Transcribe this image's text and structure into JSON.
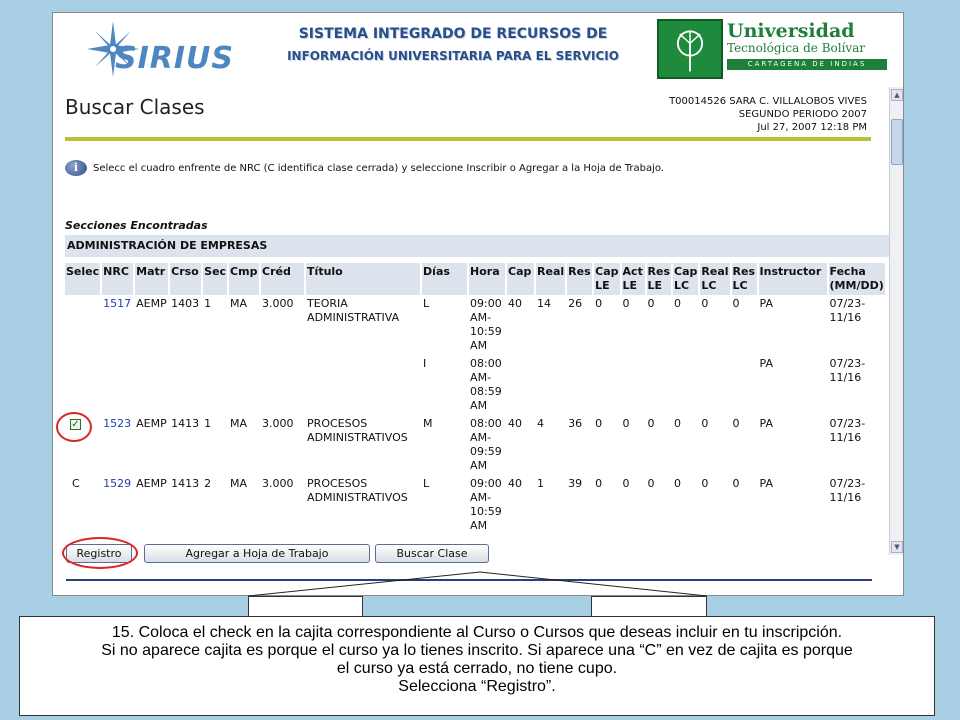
{
  "banner": {
    "sirius_logo_text": "SIRIUS",
    "system_title_line1": "SISTEMA INTEGRADO DE RECURSOS DE",
    "system_title_line2": "INFORMACIÓN UNIVERSITARIA PARA EL SERVICIO",
    "university_line1": "Universidad",
    "university_line2": "Tecnológica de Bolívar",
    "university_line3": "CARTAGENA DE INDIAS"
  },
  "page": {
    "title": "Buscar Clases",
    "user_line": "T00014526 SARA C. VILLALOBOS VIVES",
    "period_line": "SEGUNDO PERIODO 2007",
    "datetime_line": "Jul 27, 2007 12:18 PM",
    "info_message": "Selecc el cuadro enfrente de NRC (C identifica clase cerrada) y seleccione Inscribir o Agregar a la Hoja de Trabajo.",
    "sections_label": "Secciones Encontradas",
    "department": "ADMINISTRACIÓN DE EMPRESAS"
  },
  "table": {
    "headers": [
      "Selec",
      "NRC",
      "Matr",
      "Crso",
      "Sec",
      "Cmp",
      "Créd",
      "Título",
      "Días",
      "Hora",
      "Cap",
      "Real",
      "Res",
      "Cap LE",
      "Act LE",
      "Res LE",
      "Cap LC",
      "Real LC",
      "Res LC",
      "Instructor",
      "Fecha (MM/DD)"
    ],
    "rows": [
      {
        "select": "",
        "nrc": "1517",
        "matr": "AEMP",
        "crso": "1403",
        "sec": "1",
        "cmp": "MA",
        "cred": "3.000",
        "titulo": "TEORIA ADMINISTRATIVA",
        "dias": "L",
        "hora": "09:00 AM-10:59 AM",
        "cap": "40",
        "real": "14",
        "res": "26",
        "caple": "0",
        "actle": "0",
        "resle": "0",
        "caplc": "0",
        "reallc": "0",
        "reslc": "0",
        "instructor": "PA",
        "fecha": "07/23-11/16"
      },
      {
        "select": "",
        "nrc": "",
        "matr": "",
        "crso": "",
        "sec": "",
        "cmp": "",
        "cred": "",
        "titulo": "",
        "dias": "I",
        "hora": "08:00 AM-08:59 AM",
        "cap": "",
        "real": "",
        "res": "",
        "caple": "",
        "actle": "",
        "resle": "",
        "caplc": "",
        "reallc": "",
        "reslc": "",
        "instructor": "PA",
        "fecha": "07/23-11/16"
      },
      {
        "select": "checkbox",
        "nrc": "1523",
        "matr": "AEMP",
        "crso": "1413",
        "sec": "1",
        "cmp": "MA",
        "cred": "3.000",
        "titulo": "PROCESOS ADMINISTRATIVOS",
        "dias": "M",
        "hora": "08:00 AM-09:59 AM",
        "cap": "40",
        "real": "4",
        "res": "36",
        "caple": "0",
        "actle": "0",
        "resle": "0",
        "caplc": "0",
        "reallc": "0",
        "reslc": "0",
        "instructor": "PA",
        "fecha": "07/23-11/16"
      },
      {
        "select": "C",
        "nrc": "1529",
        "matr": "AEMP",
        "crso": "1413",
        "sec": "2",
        "cmp": "MA",
        "cred": "3.000",
        "titulo": "PROCESOS ADMINISTRATIVOS",
        "dias": "L",
        "hora": "09:00 AM-10:59 AM",
        "cap": "40",
        "real": "1",
        "res": "39",
        "caple": "0",
        "actle": "0",
        "resle": "0",
        "caplc": "0",
        "reallc": "0",
        "reslc": "0",
        "instructor": "PA",
        "fecha": "07/23-11/16"
      }
    ]
  },
  "buttons": {
    "registro": "Registro",
    "agregar": "Agregar a Hoja de Trabajo",
    "buscar": "Buscar Clase"
  },
  "callout": {
    "line1": "15. Coloca el check en la cajita correspondiente al Curso o Cursos que deseas incluir en tu inscripción.",
    "line2": "Si no aparece cajita es porque el curso ya lo tienes inscrito.  Si aparece una “C” en vez de cajita es porque",
    "line3": "el curso ya está cerrado, no tiene cupo.",
    "line4": "Selecciona “Registro”."
  },
  "colors": {
    "background": "#a8cfe3",
    "accent_rule": "#b9c234",
    "highlight_circle": "#d9262a",
    "link": "#1f3fb0"
  }
}
